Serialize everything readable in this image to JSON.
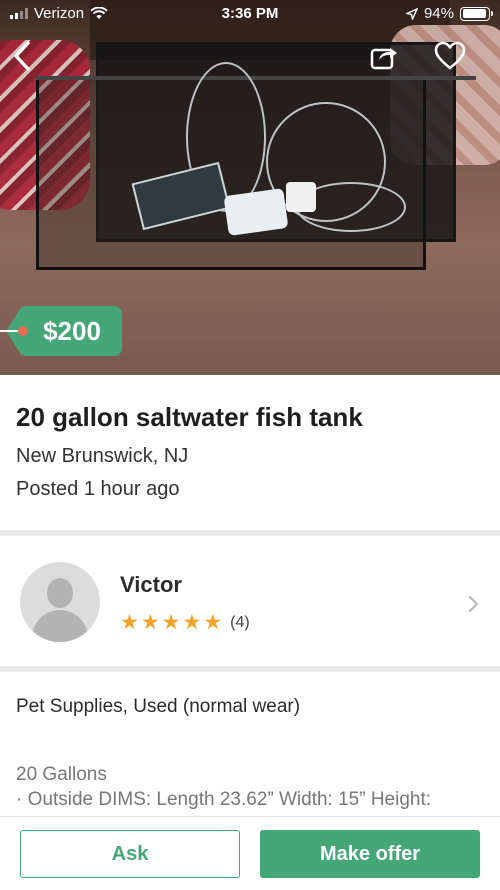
{
  "status_bar": {
    "carrier": "Verizon",
    "time": "3:36 PM",
    "battery": "94%",
    "battery_level": 0.94
  },
  "hero": {
    "image_subject": "glass fish tank with equipment",
    "icons": [
      "back-icon",
      "share-icon",
      "heart-icon"
    ]
  },
  "listing": {
    "price": "$200",
    "title": "20 gallon saltwater fish tank",
    "location": "New Brunswick, NJ",
    "posted": "Posted 1 hour ago"
  },
  "seller": {
    "name": "Victor",
    "rating": 5,
    "review_count": "(4)"
  },
  "details": {
    "category": "Pet Supplies, Used (normal wear)",
    "description_lines": [
      "20 Gallons",
      "· Outside DIMS: Length 23.62” Width: 15” Height:"
    ]
  },
  "actions": {
    "ask_label": "Ask",
    "offer_label": "Make offer"
  },
  "colors": {
    "accent": "#45a777",
    "star": "#f0a42b"
  }
}
